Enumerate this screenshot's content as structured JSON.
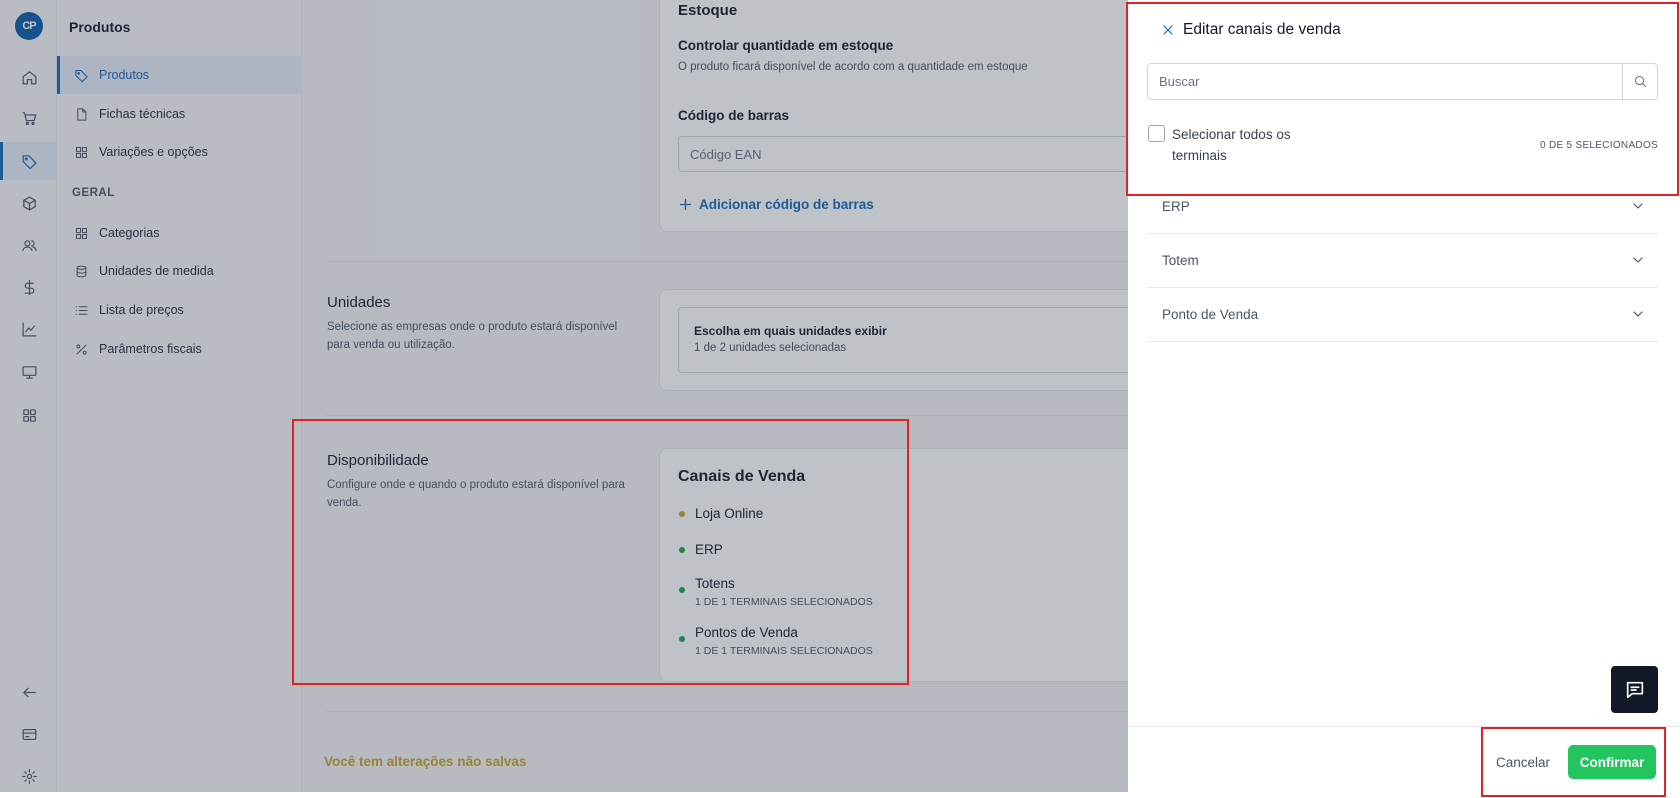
{
  "app": {
    "logo_text": "CP"
  },
  "rail": {
    "items": [
      {
        "icon": "home-icon"
      },
      {
        "icon": "cart-icon"
      },
      {
        "icon": "tag-icon"
      },
      {
        "icon": "box-icon"
      },
      {
        "icon": "users-icon"
      },
      {
        "icon": "dollar-icon"
      },
      {
        "icon": "chart-icon"
      },
      {
        "icon": "monitor-icon"
      },
      {
        "icon": "apps-icon"
      },
      {
        "icon": "back-arrow-icon"
      },
      {
        "icon": "card-icon"
      },
      {
        "icon": "gear-icon"
      }
    ]
  },
  "sidebar": {
    "title": "Produtos",
    "items": [
      {
        "label": "Produtos",
        "icon": "tag-icon"
      },
      {
        "label": "Fichas técnicas",
        "icon": "file-icon"
      },
      {
        "label": "Variações e opções",
        "icon": "grid-icon"
      }
    ],
    "section_geral": "GERAL",
    "geral_items": [
      {
        "label": "Categorias",
        "icon": "grid-icon"
      },
      {
        "label": "Unidades de medida",
        "icon": "database-icon"
      },
      {
        "label": "Lista de preços",
        "icon": "list-icon"
      },
      {
        "label": "Parâmetros fiscais",
        "icon": "percent-icon"
      }
    ]
  },
  "main": {
    "estoque": {
      "title": "Estoque",
      "control_title": "Controlar quantidade em estoque",
      "control_desc": "O produto ficará disponível de acordo com a quantidade em estoque",
      "barcode_label": "Código de barras",
      "barcode_placeholder": "Código EAN",
      "add_barcode": "Adicionar código de barras"
    },
    "unidades": {
      "title": "Unidades",
      "desc": "Selecione as empresas onde o produto estará disponível para venda ou utilização.",
      "select_title": "Escolha em quais unidades exibir",
      "select_sub": "1 de 2 unidades selecionadas"
    },
    "disponibilidade": {
      "title": "Disponibilidade",
      "desc": "Configure onde e quando o produto estará disponível para venda.",
      "card_title": "Canais de Venda",
      "channels": [
        {
          "name": "Loja Online",
          "sub": "",
          "status_color": "#c9a227"
        },
        {
          "name": "ERP",
          "sub": "",
          "status_color": "#16a34a"
        },
        {
          "name": "Totens",
          "sub": "1 DE 1 TERMINAIS SELECIONADOS",
          "status_color": "#16a34a"
        },
        {
          "name": "Pontos de Venda",
          "sub": "1 DE 1 TERMINAIS SELECIONADOS",
          "status_color": "#16a34a"
        }
      ]
    },
    "unsaved": "Você tem alterações não salvas"
  },
  "drawer": {
    "title": "Editar canais de venda",
    "search_placeholder": "Buscar",
    "select_all": "Selecionar todos os terminais",
    "count": "0 DE 5 SELECIONADOS",
    "groups": [
      {
        "label": "ERP"
      },
      {
        "label": "Totem"
      },
      {
        "label": "Ponto de Venda"
      }
    ],
    "cancel": "Cancelar",
    "confirm": "Confirmar"
  },
  "colors": {
    "accent": "#1668b8",
    "confirm": "#22c55e",
    "warning": "#c9a227",
    "highlight": "#e02424"
  }
}
